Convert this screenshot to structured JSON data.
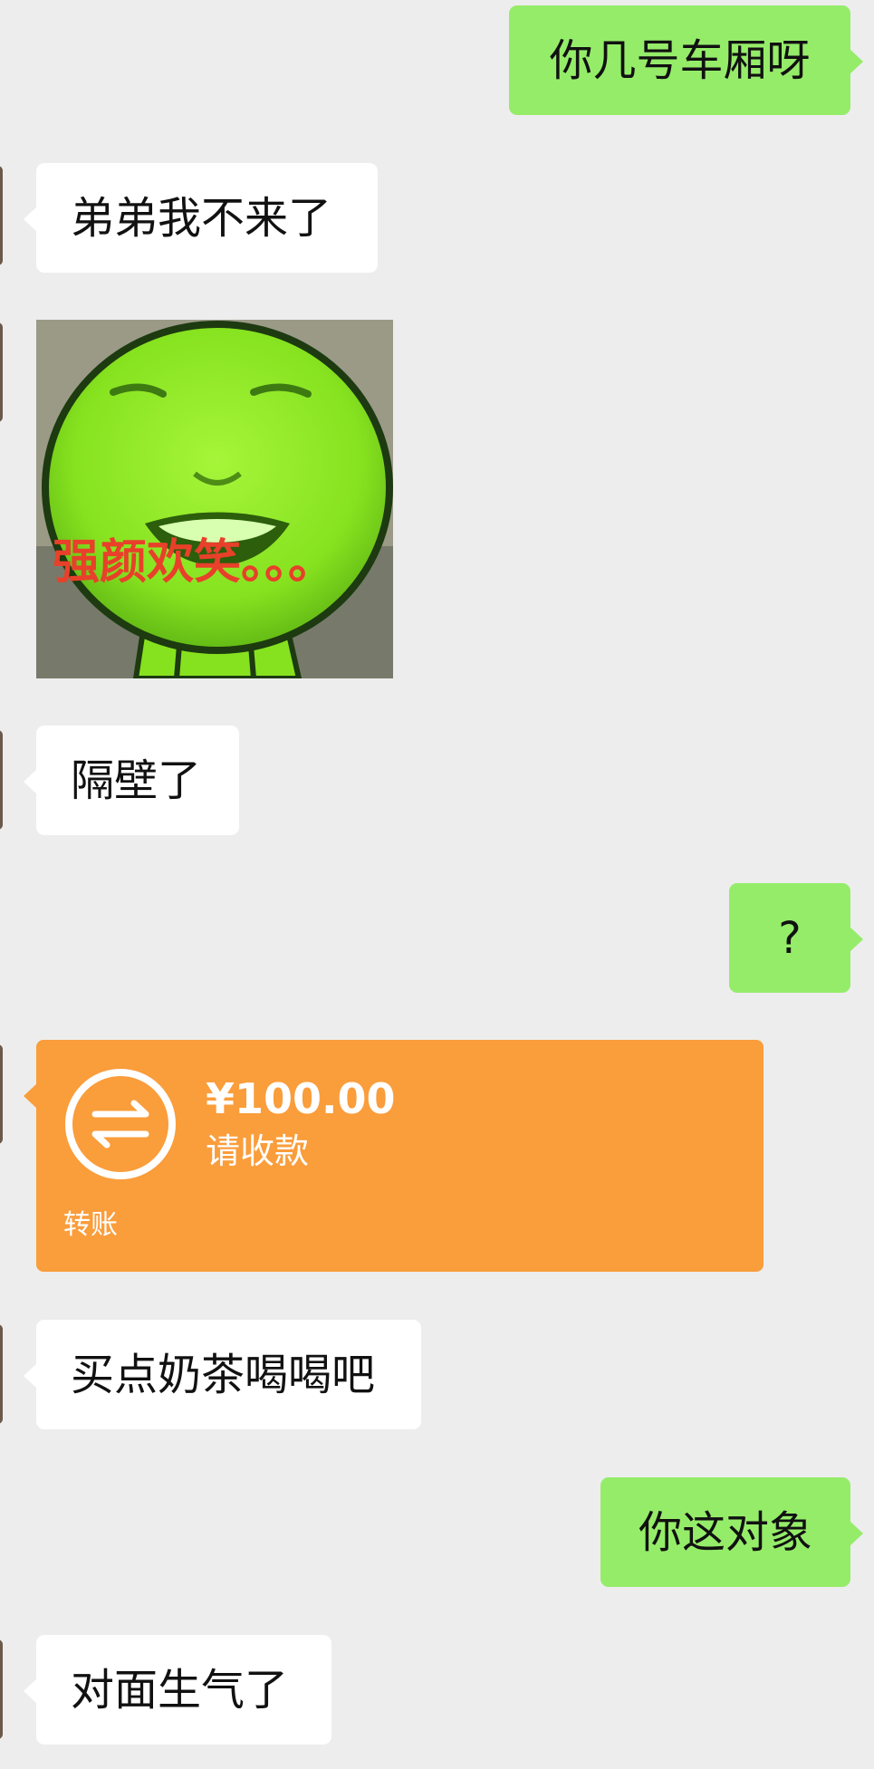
{
  "messages": {
    "m1": {
      "sender": "me",
      "text": "你几号车厢呀"
    },
    "m2": {
      "sender": "contact",
      "text": "弟弟我不来了"
    },
    "m3": {
      "sender": "contact",
      "sticker_caption": "强颜欢笑。。。"
    },
    "m4": {
      "sender": "contact",
      "text": "隔壁了"
    },
    "m5": {
      "sender": "me",
      "text": "?"
    },
    "m6": {
      "sender": "contact",
      "transfer": {
        "amount": "¥100.00",
        "status": "请收款",
        "label": "转账"
      }
    },
    "m7": {
      "sender": "contact",
      "text": "买点奶茶喝喝吧"
    },
    "m8": {
      "sender": "me",
      "text": "你这对象"
    },
    "m9": {
      "sender": "contact",
      "text": "对面生气了"
    }
  },
  "colors": {
    "background": "#ededed",
    "outgoing_bubble": "#95ec69",
    "incoming_bubble": "#ffffff",
    "transfer_card": "#fa9d3b"
  },
  "icons": {
    "transfer": "transfer-arrows-icon"
  }
}
